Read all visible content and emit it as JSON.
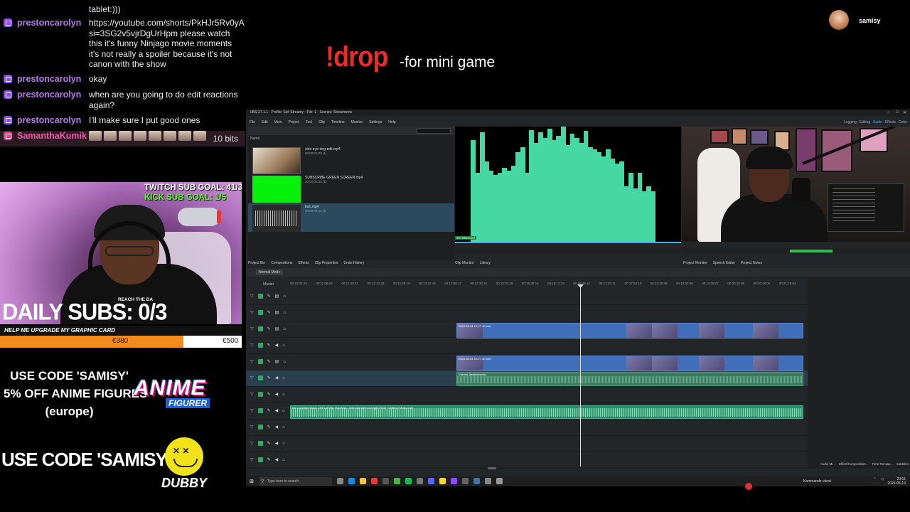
{
  "chat": {
    "partial_line": "tablet:)))",
    "messages": [
      {
        "user": "prestoncarolyn",
        "text": "https://youtube.com/shorts/PkHJr5Rv0yA?si=3SG2v5vjrDgUrHpm please watch this it's funny Ninjago movie moments it's not really a spoiler because it's not canon with the show"
      },
      {
        "user": "prestoncarolyn",
        "text": "okay"
      },
      {
        "user": "prestoncarolyn",
        "text": "when are you going to do edit reactions again?"
      },
      {
        "user": "prestoncarolyn",
        "text": "I'll make sure I put good ones"
      },
      {
        "user": "SamanthaKumik",
        "text": "",
        "bits": "10 bits"
      }
    ]
  },
  "webcam": {
    "sub_goal": "TWITCH SUB GOAL: 41/30",
    "kick_goal": "KICK SUB GOAL: 1/5",
    "reach_text": "REACH THE DA"
  },
  "daily_subs": "DAILY SUBS: 0/3",
  "upgrade_banner": "HELP ME UPGRADE MY GRAPHIC CARD",
  "donation": {
    "current": "€380",
    "target": "€500",
    "progress": 0.76
  },
  "promo": {
    "line1": "USE CODE 'SAMISY'",
    "line2": "5% OFF ANIME FIGURES",
    "line3": "(europe)",
    "anime_brand": "ANIME",
    "anime_sub": "FIGURER",
    "line4": "USE CODE 'SAMISY'",
    "dubby_brand": "DUBBY"
  },
  "drop": {
    "command": "!drop",
    "description": "-for mini game"
  },
  "streamer": {
    "name": "samisy"
  },
  "editor": {
    "title": "0BS-27.1.1 - Profile: Self Streamy - File: 1 - Scenes: Streamwow",
    "menu": [
      "File",
      "Edit",
      "View",
      "Project",
      "Tool",
      "Clip",
      "Timeline",
      "Monitor",
      "Settings",
      "Help"
    ],
    "layouts": [
      "Logging",
      "Editing",
      "Audio",
      "Effects",
      "Color"
    ],
    "bin": {
      "header": "Name",
      "clips": [
        {
          "name": "side-eye-dog-edit.mp4",
          "duration": "00:00:05:00 [1]"
        },
        {
          "name": "SUBSCRIBE GREEN SCREEN.mp4",
          "duration": "00:00:03:00 [1]"
        },
        {
          "name": "ba1.mp4",
          "duration": "00:00:04:12 [1]"
        }
      ],
      "tabs": [
        "Project Bin",
        "Compositions",
        "Effects",
        "Clip Properties",
        "Undo History"
      ]
    },
    "monitor_tag": "Zm Diamond",
    "panel_tabs_left": [
      "Clip Monitor",
      "Library"
    ],
    "panel_tabs_right": [
      "Project Monitor",
      "Speech Editor",
      "Project Notes"
    ],
    "timeline": {
      "mode": "Normal Mode",
      "master": "Master",
      "ruler": [
        "00:10:32:23",
        "00:11:06:22",
        "00:11:40:21",
        "00:12:14:20",
        "00:12:48:19",
        "00:13:22:18",
        "00:13:56:17",
        "00:14:30:16",
        "00:15:04:15",
        "00:15:38:14",
        "00:16:12:13",
        "00:16:46:12",
        "00:17:20:11",
        "00:17:54:10",
        "00:18:28:09",
        "00:19:02:08",
        "00:19:36:07",
        "00:20:10:06",
        "00:20:44:05",
        "00:21:18:04"
      ],
      "video_clip_label": "2024-06-04 19-27-40.mkv",
      "audio_clip_label": "Volume (keyframable)",
      "music_label": "No Copyright Music Chill Lofi Hip Hop Beat - Instrumental (Copyright Free) | Chillhop Music.mp3"
    },
    "bottom_tabs": [
      "Audio Mi...",
      "Effect/Composition...",
      "Time Remap...",
      "Subtitles"
    ]
  },
  "taskbar": {
    "search_placeholder": "Type here to search",
    "tray_text": "Kommande vänst",
    "clock": "23:51",
    "date": "2024-06-14"
  }
}
